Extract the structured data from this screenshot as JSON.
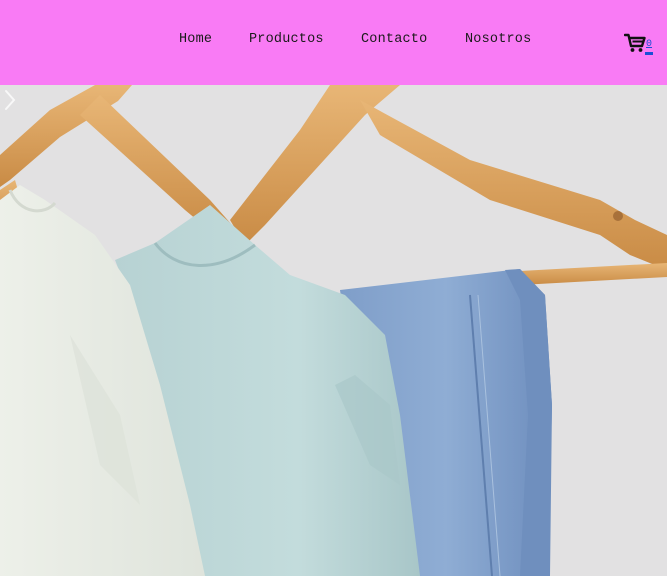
{
  "nav": {
    "items": [
      {
        "label": "Home"
      },
      {
        "label": "Productos"
      },
      {
        "label": "Contacto"
      },
      {
        "label": "Nosotros"
      }
    ]
  },
  "cart": {
    "icon": "shopping-cart-icon",
    "count": "0"
  },
  "hero": {
    "image": "clothes-on-wooden-hangers",
    "next_icon": "chevron-right-icon"
  },
  "colors": {
    "header_bg": "#f97bf5",
    "nav_text": "#1a1a1a",
    "cart_count": "#1a4fd6"
  }
}
